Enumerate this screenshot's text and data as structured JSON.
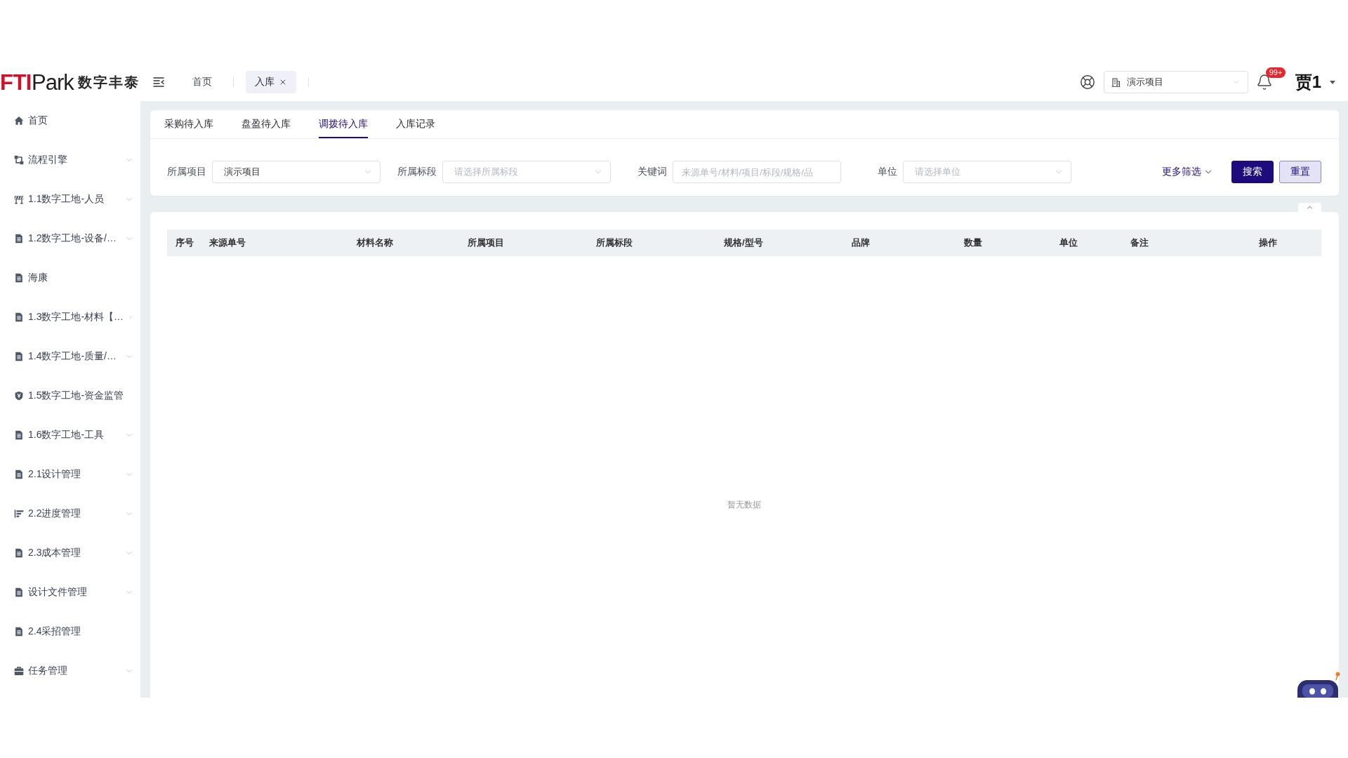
{
  "logo": {
    "wordmark_accent": "FTI",
    "wordmark": "Park",
    "tagline": "数字丰泰"
  },
  "header": {
    "tabs": [
      {
        "label": "首页",
        "selected": false,
        "closable": false
      },
      {
        "label": "入库",
        "selected": true,
        "closable": true
      }
    ],
    "project_select": {
      "value": "演示项目"
    },
    "notification_badge": "99+",
    "user_name": "贾1"
  },
  "sidebar": {
    "items": [
      {
        "label": "首页",
        "kind": "home",
        "submenu": false
      },
      {
        "label": "流程引擎",
        "kind": "flow",
        "submenu": true
      },
      {
        "label": "1.1数字工地-人员",
        "kind": "barrier",
        "submenu": true
      },
      {
        "label": "1.2数字工地-设备/…",
        "kind": "document",
        "submenu": true
      },
      {
        "label": "海康",
        "kind": "document",
        "submenu": false
      },
      {
        "label": "1.3数字工地-材料【…",
        "kind": "document",
        "submenu": true
      },
      {
        "label": "1.4数字工地-质量/…",
        "kind": "document",
        "submenu": true
      },
      {
        "label": "1.5数字工地-资金监管",
        "kind": "shield",
        "submenu": false
      },
      {
        "label": "1.6数字工地-工具",
        "kind": "document",
        "submenu": true
      },
      {
        "label": "2.1设计管理",
        "kind": "document",
        "submenu": true
      },
      {
        "label": "2.2进度管理",
        "kind": "gantt",
        "submenu": true
      },
      {
        "label": "2.3成本管理",
        "kind": "document",
        "submenu": true
      },
      {
        "label": "设计文件管理",
        "kind": "document",
        "submenu": true
      },
      {
        "label": "2.4采招管理",
        "kind": "document",
        "submenu": false
      },
      {
        "label": "任务管理",
        "kind": "briefcase",
        "submenu": true
      }
    ]
  },
  "page_tabs": [
    {
      "label": "采购待入库",
      "selected": false
    },
    {
      "label": "盘盈待入库",
      "selected": false
    },
    {
      "label": "调拨待入库",
      "selected": true
    },
    {
      "label": "入库记录",
      "selected": false
    }
  ],
  "filters": [
    {
      "label": "所属项目",
      "kind": "select",
      "value": "演示项目"
    },
    {
      "label": "所属标段",
      "kind": "select",
      "placeholder": "请选择所属标段"
    },
    {
      "label": "关键词",
      "kind": "input",
      "placeholder": "来源单号/材料/项目/标段/规格/品"
    },
    {
      "label": "单位",
      "kind": "select",
      "placeholder": "请选择单位"
    }
  ],
  "filter_actions": [
    {
      "label": "更多筛选",
      "kind": "link"
    },
    {
      "label": "搜索",
      "kind": "primary"
    },
    {
      "label": "重置",
      "kind": "secondary"
    }
  ],
  "table": {
    "columns": [
      "序号",
      "来源单号",
      "材料名称",
      "所属项目",
      "所属标段",
      "规格/型号",
      "品牌",
      "数量",
      "单位",
      "备注",
      "操作"
    ],
    "empty_text": "暂无数据"
  }
}
